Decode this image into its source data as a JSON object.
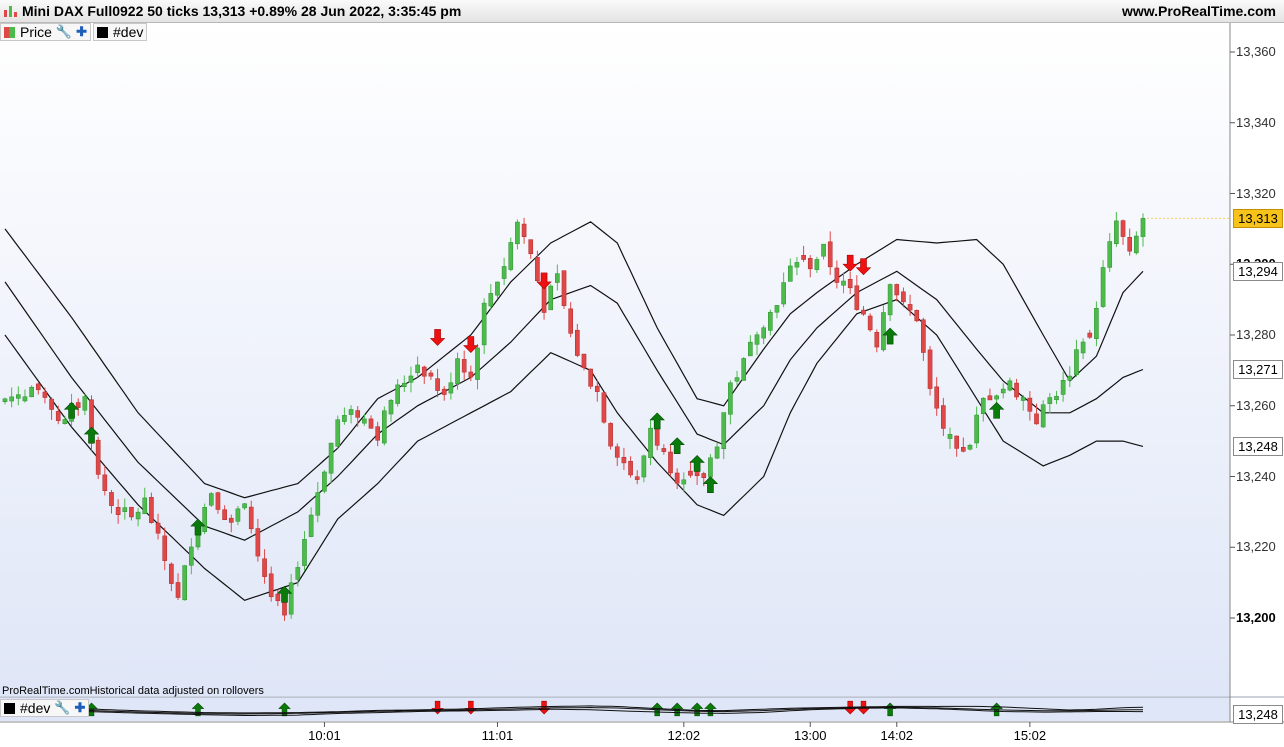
{
  "title": "Mini DAX Full0922 50 ticks 13,313 +0.89% 28 Jun 2022, 3:35:45 pm",
  "site": "www.ProRealTime.com",
  "legend": [
    {
      "label": "Price",
      "color": "#4db24d"
    },
    {
      "label": "#dev",
      "color": "#000000"
    }
  ],
  "footer_note": "ProRealTime.comHistorical data adjusted on rollovers",
  "sub_legend": "#dev",
  "colors": {
    "up": "#4cbb4c",
    "down": "#e04848",
    "arrow_up": "#0a7a0a",
    "arrow_down": "#ee1111",
    "bg_top": "#ffffff",
    "bg_bottom": "#dfe6f7",
    "current_price": "#f7c21a"
  },
  "tags": {
    "price": "13,313",
    "upper": "13,294",
    "mid": "13,271",
    "lower": "13,248",
    "sub": "13,248"
  },
  "chart_data": {
    "type": "candlestick",
    "y_ticks": [
      {
        "value": 13360,
        "label": "13,360",
        "bold": false
      },
      {
        "value": 13340,
        "label": "13,340",
        "bold": false
      },
      {
        "value": 13320,
        "label": "13,320",
        "bold": false
      },
      {
        "value": 13300,
        "label": "13,300",
        "bold": true
      },
      {
        "value": 13280,
        "label": "13,280",
        "bold": false
      },
      {
        "value": 13260,
        "label": "13,260",
        "bold": false
      },
      {
        "value": 13240,
        "label": "13,240",
        "bold": false
      },
      {
        "value": 13220,
        "label": "13,220",
        "bold": false
      },
      {
        "value": 13200,
        "label": "13,200",
        "bold": true
      }
    ],
    "ylim": [
      13190,
      13368
    ],
    "bars": 172,
    "x_ticks": [
      {
        "bar": 48,
        "label": "10:01"
      },
      {
        "bar": 74,
        "label": "11:01"
      },
      {
        "bar": 102,
        "label": "12:02"
      },
      {
        "bar": 121,
        "label": "13:00"
      },
      {
        "bar": 134,
        "label": "14:02"
      },
      {
        "bar": 154,
        "label": "15:02"
      }
    ],
    "close_anchors": [
      [
        0,
        13262
      ],
      [
        4,
        13265
      ],
      [
        8,
        13256
      ],
      [
        12,
        13262
      ],
      [
        14,
        13240
      ],
      [
        16,
        13232
      ],
      [
        19,
        13228
      ],
      [
        21,
        13233
      ],
      [
        23,
        13222
      ],
      [
        26,
        13205
      ],
      [
        28,
        13222
      ],
      [
        31,
        13236
      ],
      [
        34,
        13226
      ],
      [
        36,
        13234
      ],
      [
        38,
        13218
      ],
      [
        40,
        13206
      ],
      [
        42,
        13200
      ],
      [
        44,
        13216
      ],
      [
        47,
        13236
      ],
      [
        50,
        13256
      ],
      [
        53,
        13258
      ],
      [
        56,
        13252
      ],
      [
        58,
        13262
      ],
      [
        62,
        13272
      ],
      [
        64,
        13268
      ],
      [
        66,
        13262
      ],
      [
        68,
        13274
      ],
      [
        70,
        13268
      ],
      [
        72,
        13288
      ],
      [
        75,
        13300
      ],
      [
        77,
        13312
      ],
      [
        79,
        13303
      ],
      [
        81,
        13288
      ],
      [
        83,
        13296
      ],
      [
        85,
        13280
      ],
      [
        87,
        13270
      ],
      [
        89,
        13264
      ],
      [
        91,
        13250
      ],
      [
        93,
        13244
      ],
      [
        95,
        13238
      ],
      [
        97,
        13254
      ],
      [
        99,
        13246
      ],
      [
        101,
        13240
      ],
      [
        103,
        13242
      ],
      [
        105,
        13240
      ],
      [
        107,
        13250
      ],
      [
        109,
        13266
      ],
      [
        111,
        13272
      ],
      [
        113,
        13282
      ],
      [
        115,
        13286
      ],
      [
        117,
        13294
      ],
      [
        119,
        13302
      ],
      [
        121,
        13300
      ],
      [
        123,
        13304
      ],
      [
        125,
        13296
      ],
      [
        127,
        13292
      ],
      [
        129,
        13286
      ],
      [
        131,
        13278
      ],
      [
        133,
        13296
      ],
      [
        135,
        13288
      ],
      [
        137,
        13285
      ],
      [
        139,
        13264
      ],
      [
        141,
        13254
      ],
      [
        143,
        13246
      ],
      [
        145,
        13250
      ],
      [
        147,
        13262
      ],
      [
        149,
        13264
      ],
      [
        151,
        13266
      ],
      [
        153,
        13262
      ],
      [
        155,
        13256
      ],
      [
        157,
        13262
      ],
      [
        159,
        13266
      ],
      [
        161,
        13274
      ],
      [
        163,
        13280
      ],
      [
        165,
        13298
      ],
      [
        167,
        13312
      ],
      [
        169,
        13302
      ],
      [
        171,
        13313
      ]
    ],
    "upper_band": [
      [
        0,
        13310
      ],
      [
        10,
        13285
      ],
      [
        20,
        13258
      ],
      [
        30,
        13238
      ],
      [
        36,
        13234
      ],
      [
        44,
        13238
      ],
      [
        50,
        13248
      ],
      [
        56,
        13262
      ],
      [
        62,
        13268
      ],
      [
        70,
        13280
      ],
      [
        76,
        13295
      ],
      [
        82,
        13306
      ],
      [
        88,
        13312
      ],
      [
        92,
        13306
      ],
      [
        98,
        13282
      ],
      [
        104,
        13262
      ],
      [
        108,
        13260
      ],
      [
        114,
        13276
      ],
      [
        118,
        13286
      ],
      [
        122,
        13292
      ],
      [
        128,
        13300
      ],
      [
        134,
        13307
      ],
      [
        140,
        13306
      ],
      [
        146,
        13307
      ],
      [
        150,
        13300
      ],
      [
        156,
        13280
      ],
      [
        160,
        13267
      ],
      [
        164,
        13274
      ],
      [
        168,
        13292
      ],
      [
        172,
        13300
      ]
    ],
    "mid_band": [
      [
        0,
        13295
      ],
      [
        10,
        13268
      ],
      [
        20,
        13244
      ],
      [
        30,
        13226
      ],
      [
        36,
        13222
      ],
      [
        44,
        13230
      ],
      [
        50,
        13240
      ],
      [
        56,
        13252
      ],
      [
        62,
        13260
      ],
      [
        70,
        13268
      ],
      [
        76,
        13278
      ],
      [
        82,
        13290
      ],
      [
        88,
        13294
      ],
      [
        92,
        13289
      ],
      [
        98,
        13270
      ],
      [
        104,
        13252
      ],
      [
        108,
        13249
      ],
      [
        114,
        13260
      ],
      [
        118,
        13273
      ],
      [
        122,
        13282
      ],
      [
        128,
        13292
      ],
      [
        134,
        13298
      ],
      [
        140,
        13290
      ],
      [
        146,
        13276
      ],
      [
        150,
        13267
      ],
      [
        156,
        13258
      ],
      [
        160,
        13258
      ],
      [
        164,
        13262
      ],
      [
        168,
        13268
      ],
      [
        172,
        13271
      ]
    ],
    "lower_band": [
      [
        0,
        13280
      ],
      [
        10,
        13254
      ],
      [
        20,
        13232
      ],
      [
        30,
        13214
      ],
      [
        36,
        13205
      ],
      [
        44,
        13210
      ],
      [
        50,
        13228
      ],
      [
        56,
        13238
      ],
      [
        62,
        13250
      ],
      [
        70,
        13258
      ],
      [
        76,
        13264
      ],
      [
        82,
        13275
      ],
      [
        88,
        13270
      ],
      [
        92,
        13258
      ],
      [
        98,
        13244
      ],
      [
        104,
        13232
      ],
      [
        108,
        13229
      ],
      [
        114,
        13240
      ],
      [
        118,
        13258
      ],
      [
        122,
        13272
      ],
      [
        128,
        13286
      ],
      [
        134,
        13290
      ],
      [
        140,
        13280
      ],
      [
        146,
        13262
      ],
      [
        150,
        13250
      ],
      [
        156,
        13243
      ],
      [
        160,
        13246
      ],
      [
        164,
        13250
      ],
      [
        168,
        13250
      ],
      [
        172,
        13248
      ]
    ],
    "arrows_up": [
      [
        10,
        13257
      ],
      [
        13,
        13250
      ],
      [
        29,
        13224
      ],
      [
        42,
        13205
      ],
      [
        98,
        13254
      ],
      [
        101,
        13247
      ],
      [
        104,
        13242
      ],
      [
        106,
        13236
      ],
      [
        133,
        13278
      ],
      [
        149,
        13257
      ]
    ],
    "arrows_down": [
      [
        65,
        13281
      ],
      [
        70,
        13279
      ],
      [
        81,
        13297
      ],
      [
        127,
        13302
      ],
      [
        129,
        13301
      ]
    ]
  }
}
